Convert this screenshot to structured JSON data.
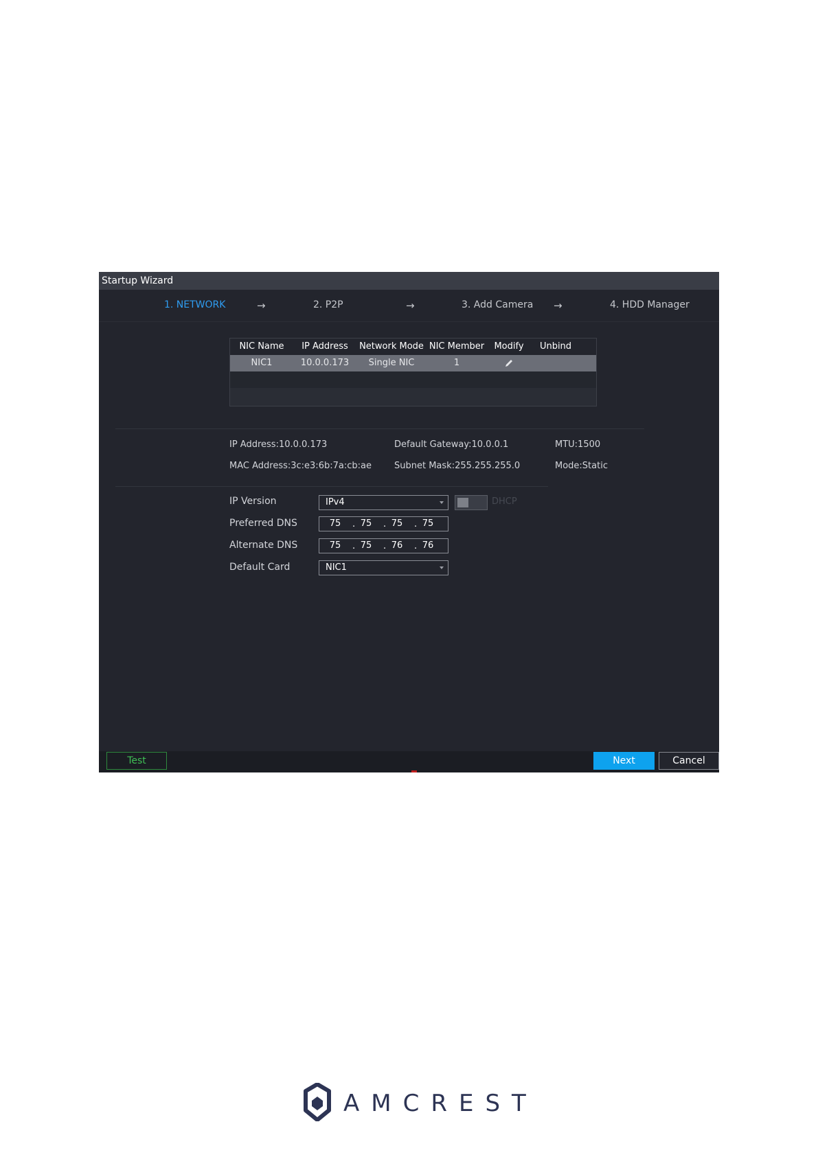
{
  "window": {
    "title": "Startup Wizard"
  },
  "steps": [
    {
      "label": "1.  NETWORK",
      "active": true
    },
    {
      "label": "2.  P2P",
      "active": false
    },
    {
      "label": "3.  Add Camera",
      "active": false
    },
    {
      "label": "4.  HDD Manager",
      "active": false
    }
  ],
  "arrow_glyph": "→",
  "nic_table": {
    "headers": [
      "NIC Name",
      "IP Address",
      "Network Mode",
      "NIC Member",
      "Modify",
      "Unbind"
    ],
    "rows": [
      {
        "nic_name": "NIC1",
        "ip_address": "10.0.0.173",
        "network_mode": "Single NIC",
        "nic_member": "1",
        "modify_icon": "pencil-icon",
        "unbind": ""
      }
    ]
  },
  "info": {
    "ip_address": "IP Address:10.0.0.173",
    "default_gateway": "Default Gateway:10.0.0.1",
    "mtu": "MTU:1500",
    "mac_address": "MAC Address:3c:e3:6b:7a:cb:ae",
    "subnet_mask": "Subnet Mask:255.255.255.0",
    "mode": "Mode:Static"
  },
  "form": {
    "ip_version": {
      "label": "IP Version",
      "value": "IPv4"
    },
    "dhcp": {
      "label": "DHCP",
      "enabled": false
    },
    "preferred_dns": {
      "label": "Preferred DNS",
      "octets": [
        "75",
        "75",
        "75",
        "75"
      ]
    },
    "alternate_dns": {
      "label": "Alternate DNS",
      "octets": [
        "75",
        "75",
        "76",
        "76"
      ]
    },
    "default_card": {
      "label": "Default Card",
      "value": "NIC1"
    }
  },
  "buttons": {
    "test": "Test",
    "next": "Next",
    "cancel": "Cancel"
  },
  "logo": {
    "text": "AMCREST",
    "color": "#2d3454"
  },
  "colors": {
    "accent": "#0ea2ee",
    "active_step": "#2f9cf0",
    "test_green": "#3fbf55",
    "panel_bg": "#23252d"
  }
}
